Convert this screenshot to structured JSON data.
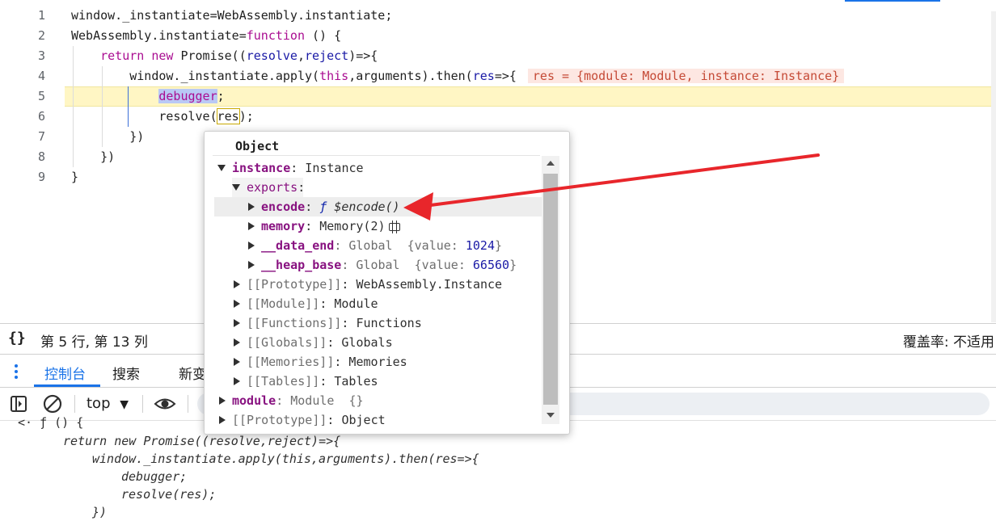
{
  "editor": {
    "line_numbers": [
      "1",
      "2",
      "3",
      "4",
      "5",
      "6",
      "7",
      "8",
      "9"
    ],
    "line1": "window._instantiate=WebAssembly.instantiate;",
    "line2_a": "WebAssembly.instantiate=",
    "line2_kw": "function",
    "line2_b": " () {",
    "line3_kw1": "return",
    "line3_kw2": "new",
    "line3_a": " Promise((",
    "line3_p1": "resolve",
    "line3_comma": ",",
    "line3_p2": "reject",
    "line3_b": ")=>{",
    "line4_a": "window._instantiate.apply(",
    "line4_this": "this",
    "line4_b": ",arguments).then(",
    "line4_res": "res",
    "line4_c": "=>{",
    "line4_inline": "res = {module: Module, instance: Instance}",
    "line5_dbg": "debugger",
    "line5_semi": ";",
    "line6_a": "resolve(",
    "line6_res": "res",
    "line6_b": ");",
    "line7": "})",
    "line8": "})",
    "line9": "}"
  },
  "status": {
    "braces_icon": "{}",
    "position": "第 5 行, 第 13 列",
    "coverage": "覆盖率: 不适用"
  },
  "drawer": {
    "tab_console": "控制台",
    "tab_search": "搜索",
    "tab_new": "新变"
  },
  "console_toolbar": {
    "context": "top",
    "context_caret": "▼"
  },
  "console_output": {
    "l0": "<· ƒ () {",
    "l1": "return new Promise((resolve,reject)=>{",
    "l2": "window._instantiate.apply(this,arguments).then(res=>{",
    "l3": "debugger;",
    "l4": "resolve(res);",
    "l5": "})"
  },
  "popover": {
    "title": "Object",
    "rows": {
      "instance_key": "instance",
      "instance_val": ": Instance",
      "exports_key": "exports",
      "exports_colon": ":",
      "encode_key": "encode",
      "encode_colon": ": ",
      "encode_f": "ƒ ",
      "encode_val": "$encode()",
      "memory_key": "memory",
      "memory_val": ": Memory(2)",
      "data_end_key": "__data_end",
      "data_end_type": ": Global  {value: ",
      "data_end_num": "1024",
      "data_end_close": "}",
      "heap_base_key": "__heap_base",
      "heap_base_type": ": Global  {value: ",
      "heap_base_num": "66560",
      "heap_base_close": "}",
      "proto1_key": "[[Prototype]]",
      "proto1_val": ": WebAssembly.Instance",
      "module_int_key": "[[Module]]",
      "module_int_val": ": Module",
      "functions_key": "[[Functions]]",
      "functions_val": ": Functions",
      "globals_key": "[[Globals]]",
      "globals_val": ": Globals",
      "memories_key": "[[Memories]]",
      "memories_val": ": Memories",
      "tables_key": "[[Tables]]",
      "tables_val": ": Tables",
      "module_key": "module",
      "module_val": ": Module  {}",
      "proto2_key": "[[Prototype]]",
      "proto2_val": ": Object"
    }
  },
  "colors": {
    "accent": "#1a73e8",
    "annotation_arrow": "#e8262b",
    "highlight_line": "#fff6c4"
  }
}
